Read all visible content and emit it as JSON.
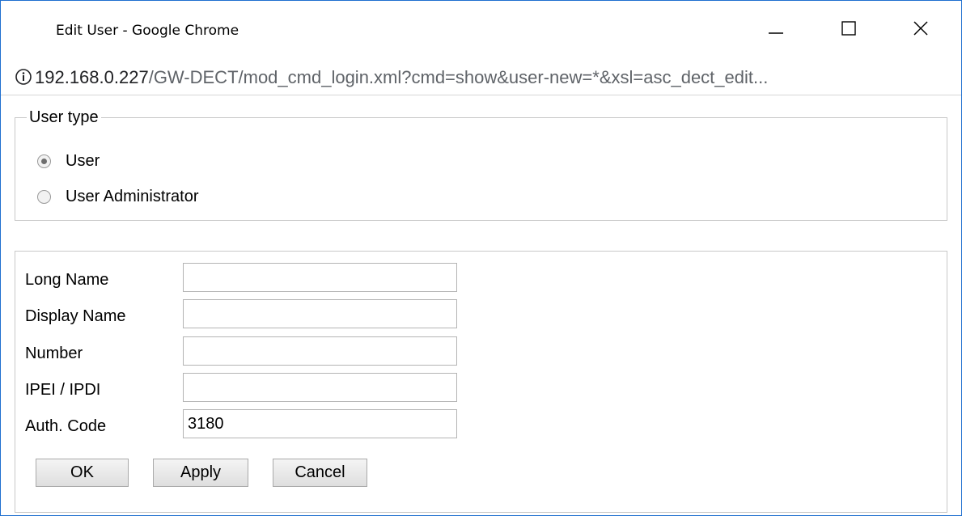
{
  "window": {
    "title": "Edit User - Google Chrome",
    "controls": [
      "minimize",
      "maximize",
      "close"
    ]
  },
  "address_bar": {
    "host": "192.168.0.227",
    "path": "/GW-DECT/mod_cmd_login.xml?cmd=show&user-new=*&xsl=asc_dect_edit...",
    "icon": "info-icon"
  },
  "user_type": {
    "legend": "User type",
    "options": [
      {
        "label": "User",
        "checked": true
      },
      {
        "label": "User Administrator",
        "checked": false
      }
    ]
  },
  "form": {
    "fields": [
      {
        "label": "Long Name",
        "value": ""
      },
      {
        "label": "Display Name",
        "value": ""
      },
      {
        "label": "Number",
        "value": ""
      },
      {
        "label": "IPEI / IPDI",
        "value": ""
      },
      {
        "label": "Auth. Code",
        "value": "3180"
      }
    ],
    "buttons": {
      "ok": "OK",
      "apply": "Apply",
      "cancel": "Cancel"
    }
  },
  "colors": {
    "window_border": "#1e6fcf",
    "fieldset_border": "#c8c8c8"
  }
}
